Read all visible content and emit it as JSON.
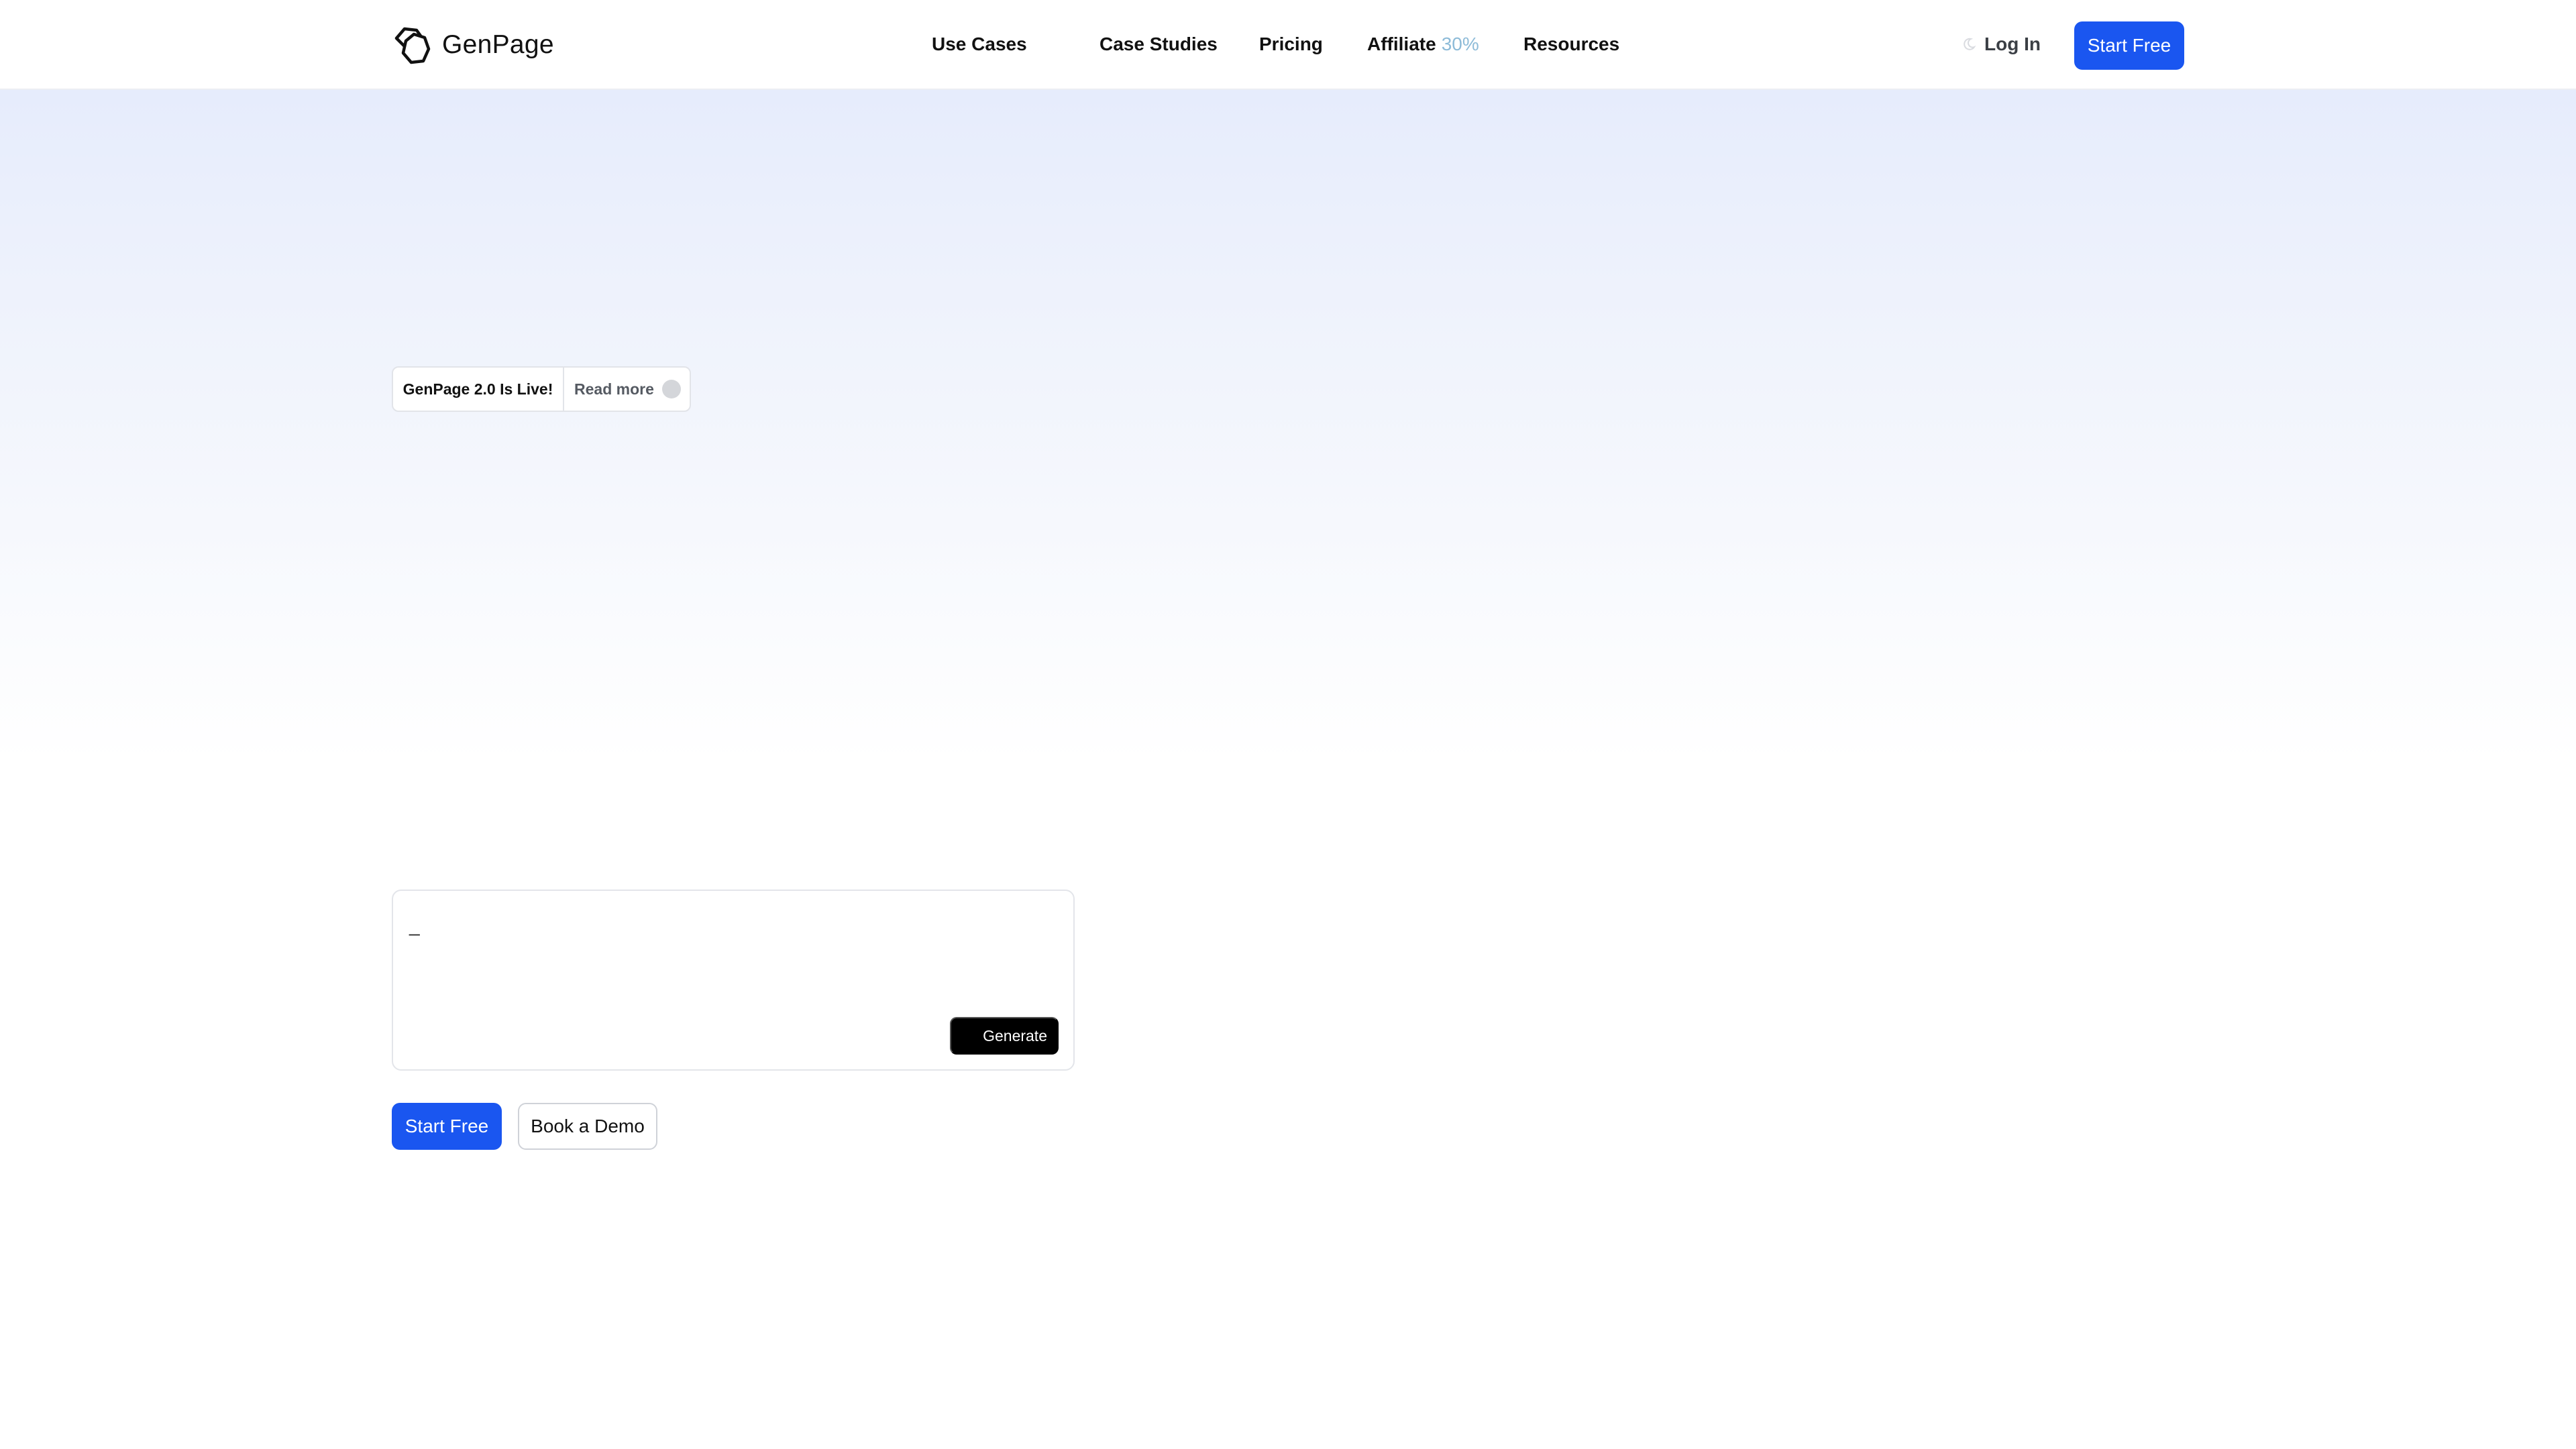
{
  "header": {
    "brand": "GenPage",
    "nav": [
      {
        "label": "Use Cases"
      },
      {
        "label": "Case Studies"
      },
      {
        "label": "Pricing"
      },
      {
        "label": "Affiliate",
        "badge": "30%"
      },
      {
        "label": "Resources"
      }
    ],
    "login_label": "Log In",
    "start_label": "Start Free"
  },
  "hero": {
    "announcement": {
      "title": "GenPage 2.0 Is Live!",
      "link": "Read more"
    },
    "prompt": {
      "value": "_",
      "generate_label": "Generate"
    },
    "cta": {
      "primary": "Start Free",
      "secondary": "Book a Demo"
    }
  },
  "colors": {
    "accent": "#1a56f0",
    "affiliate_badge": "#8dbbd8",
    "generate_button": "#000000",
    "hero_gradient_top": "#e6ecfc"
  },
  "icons": {
    "logo": "hexagon-cube-logo-icon",
    "login": "moon-icon"
  }
}
